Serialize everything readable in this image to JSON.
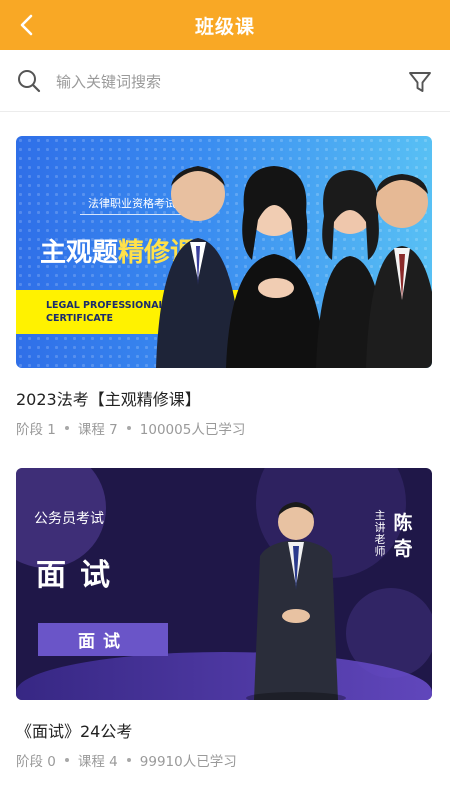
{
  "header": {
    "title": "班级课"
  },
  "search": {
    "placeholder": "输入关键词搜索"
  },
  "colors": {
    "accent": "#f9a825"
  },
  "icons": {
    "back": "chevron-left-icon",
    "search": "search-icon",
    "filter": "filter-icon"
  },
  "courses": [
    {
      "title": "2023法考【主观精修课】",
      "stage": "阶段 1",
      "lessons": "课程 7",
      "learners": "100005人已学习",
      "banner": {
        "subtitle": "法律职业资格考试",
        "headline_a": "主观题",
        "headline_b": "精修课",
        "english_line1": "LEGAL PROFESSIONAL QU",
        "english_line2": "CERTIFICATE"
      }
    },
    {
      "title": "《面试》24公考",
      "stage": "阶段 0",
      "lessons": "课程 4",
      "learners": "99910人已学习",
      "banner": {
        "tag": "公务员考试",
        "headline": "面试",
        "pill": "面试",
        "teacher_label": "主讲老师",
        "teacher_name": "陈奇"
      }
    }
  ]
}
